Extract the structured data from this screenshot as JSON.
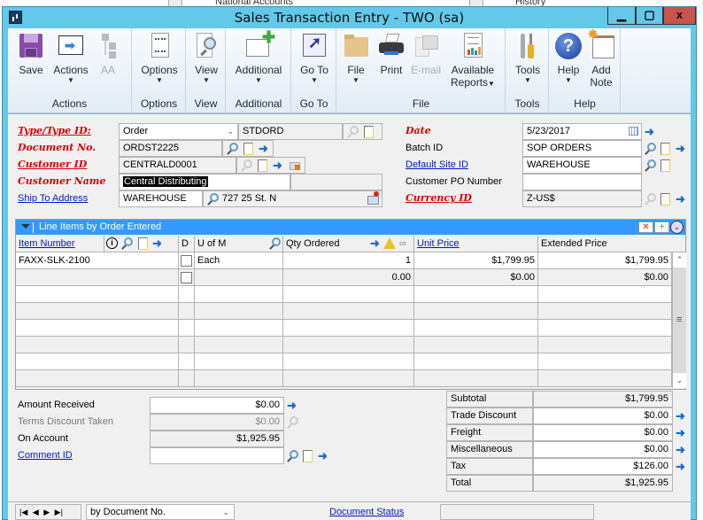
{
  "background_window": {
    "left_text": "National Accounts",
    "right_text": "History"
  },
  "window": {
    "title": "Sales Transaction Entry  -  TWO (sa)",
    "buttons": {
      "minimize": "‒",
      "maximize": "☐",
      "close": "x"
    }
  },
  "ribbon": {
    "groups": [
      {
        "label": "Actions",
        "buttons": [
          {
            "label": "Save",
            "icon": "floppy-disk-icon",
            "dropdown": false,
            "enabled": true
          },
          {
            "label": "Actions",
            "icon": "actions-arrow-icon",
            "dropdown": true,
            "enabled": true
          },
          {
            "label": "AA",
            "icon": "hierarchy-icon",
            "dropdown": false,
            "enabled": false
          }
        ]
      },
      {
        "label": "Options",
        "buttons": [
          {
            "label": "Options",
            "icon": "list-document-icon",
            "dropdown": true,
            "enabled": true
          }
        ]
      },
      {
        "label": "View",
        "buttons": [
          {
            "label": "View",
            "icon": "document-magnifier-icon",
            "dropdown": true,
            "enabled": true
          }
        ]
      },
      {
        "label": "Additional",
        "buttons": [
          {
            "label": "Additional",
            "icon": "window-plus-icon",
            "dropdown": true,
            "enabled": true
          }
        ]
      },
      {
        "label": "Go To",
        "buttons": [
          {
            "label": "Go To",
            "icon": "shortcut-arrow-icon",
            "dropdown": true,
            "enabled": true
          }
        ]
      },
      {
        "label": "File",
        "buttons": [
          {
            "label": "File",
            "icon": "folder-icon",
            "dropdown": true,
            "enabled": true
          },
          {
            "label": "Print",
            "icon": "printer-icon",
            "dropdown": false,
            "enabled": true
          },
          {
            "label": "E-mail",
            "icon": "email-icon",
            "dropdown": false,
            "enabled": false
          },
          {
            "label": "Available Reports",
            "label_line1": "Available",
            "label_line2": "Reports",
            "icon": "report-chart-icon",
            "dropdown": true,
            "enabled": true
          }
        ]
      },
      {
        "label": "Tools",
        "buttons": [
          {
            "label": "Tools",
            "icon": "wrench-screwdriver-icon",
            "dropdown": true,
            "enabled": true
          }
        ]
      },
      {
        "label": "Help",
        "buttons": [
          {
            "label": "Help",
            "icon": "help-question-icon",
            "dropdown": true,
            "enabled": true
          },
          {
            "label": "Add Note",
            "label_line1": "Add",
            "label_line2": "Note",
            "icon": "note-star-icon",
            "dropdown": false,
            "enabled": true
          }
        ]
      }
    ]
  },
  "header": {
    "type_type_id": {
      "label": "Type/Type ID:",
      "type_value": "Order",
      "type_id_value": "STDORD"
    },
    "document_no": {
      "label": "Document No.",
      "value": "ORDST2225"
    },
    "customer_id": {
      "label": "Customer ID",
      "value": "CENTRALD0001"
    },
    "customer_name": {
      "label": "Customer Name",
      "value": "Central Distributing"
    },
    "ship_to_address": {
      "label": "Ship To Address",
      "value": "WAREHOUSE",
      "address": "727 25 St. N"
    },
    "date": {
      "label": "Date",
      "value": "5/23/2017"
    },
    "batch_id": {
      "label": "Batch ID",
      "value": "SOP ORDERS"
    },
    "default_site_id": {
      "label": "Default Site ID",
      "value": "WAREHOUSE"
    },
    "customer_po_number": {
      "label": "Customer PO Number",
      "value": ""
    },
    "currency_id": {
      "label": "Currency ID",
      "value": "Z-US$"
    }
  },
  "line_items": {
    "title": "Line Items by Order Entered",
    "columns": {
      "item_number": "Item Number",
      "d": "D",
      "u_of_m": "U of M",
      "qty_ordered": "Qty Ordered",
      "unit_price": "Unit Price",
      "extended_price": "Extended Price"
    },
    "rows": [
      {
        "item_number": "FAXX-SLK-2100",
        "d": false,
        "u_of_m": "Each",
        "qty_ordered": "1",
        "unit_price": "$1,799.95",
        "extended_price": "$1,799.95"
      },
      {
        "item_number": "",
        "d": false,
        "u_of_m": "",
        "qty_ordered": "0.00",
        "unit_price": "$0.00",
        "extended_price": "$0.00"
      },
      {
        "item_number": "",
        "u_of_m": "",
        "qty_ordered": "",
        "unit_price": "",
        "extended_price": ""
      },
      {
        "item_number": "",
        "u_of_m": "",
        "qty_ordered": "",
        "unit_price": "",
        "extended_price": ""
      },
      {
        "item_number": "",
        "u_of_m": "",
        "qty_ordered": "",
        "unit_price": "",
        "extended_price": ""
      },
      {
        "item_number": "",
        "u_of_m": "",
        "qty_ordered": "",
        "unit_price": "",
        "extended_price": ""
      },
      {
        "item_number": "",
        "u_of_m": "",
        "qty_ordered": "",
        "unit_price": "",
        "extended_price": ""
      },
      {
        "item_number": "",
        "u_of_m": "",
        "qty_ordered": "",
        "unit_price": "",
        "extended_price": ""
      }
    ]
  },
  "payment": {
    "amount_received": {
      "label": "Amount Received",
      "value": "$0.00"
    },
    "terms_discount_taken": {
      "label": "Terms Discount Taken",
      "value": "$0.00"
    },
    "on_account": {
      "label": "On Account",
      "value": "$1,925.95"
    },
    "comment_id": {
      "label": "Comment ID",
      "value": ""
    }
  },
  "totals": {
    "subtotal": {
      "label": "Subtotal",
      "value": "$1,799.95"
    },
    "trade_discount": {
      "label": "Trade Discount",
      "value": "$0.00"
    },
    "freight": {
      "label": "Freight",
      "value": "$0.00"
    },
    "miscellaneous": {
      "label": "Miscellaneous",
      "value": "$0.00"
    },
    "tax": {
      "label": "Tax",
      "value": "$126.00"
    },
    "total": {
      "label": "Total",
      "value": "$1,925.95"
    }
  },
  "footer": {
    "nav": {
      "first": "|◀",
      "prev": "◀",
      "next": "▶",
      "last": "▶|"
    },
    "sort_by": "by Document No.",
    "document_status": "Document Status",
    "status_field": ""
  }
}
